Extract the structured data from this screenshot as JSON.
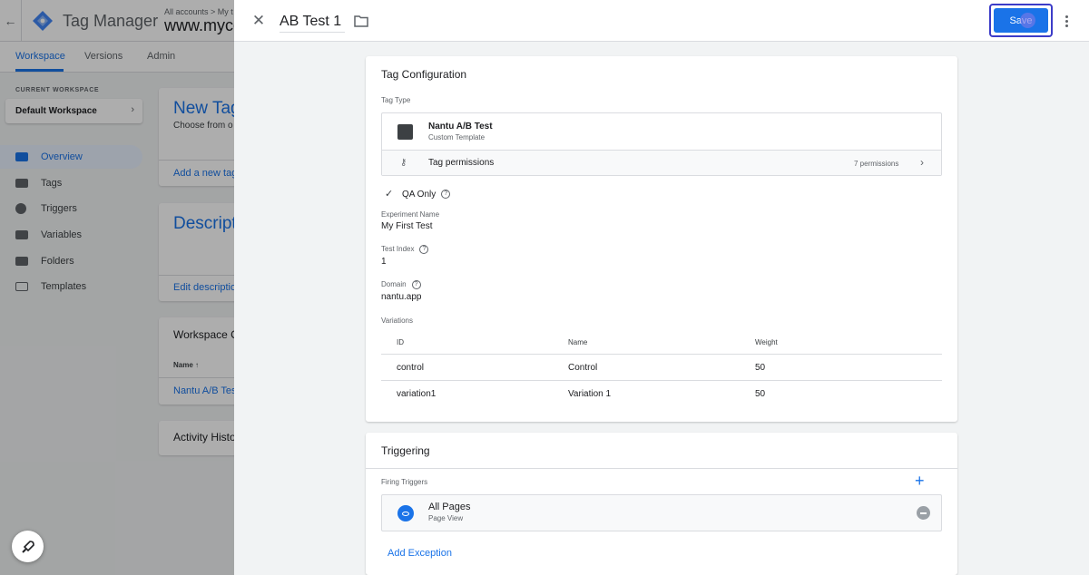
{
  "app": {
    "product_name": "Tag Manager",
    "account_crumb": "All accounts  >  My t",
    "container_name": "www.myco",
    "nav_tabs": [
      "Workspace",
      "Versions",
      "Admin"
    ],
    "current_workspace_label": "CURRENT WORKSPACE",
    "workspace_name": "Default Workspace",
    "sidebar": [
      {
        "label": "Overview",
        "icon": "overview-icon",
        "active": true
      },
      {
        "label": "Tags",
        "icon": "tag-icon"
      },
      {
        "label": "Triggers",
        "icon": "trigger-icon"
      },
      {
        "label": "Variables",
        "icon": "variables-icon"
      },
      {
        "label": "Folders",
        "icon": "folder-icon"
      },
      {
        "label": "Templates",
        "icon": "template-icon"
      }
    ],
    "cards": {
      "new_tag_title": "New Tag",
      "new_tag_sub": "Choose from o",
      "new_tag_link": "Add a new tag",
      "description_title": "Descript",
      "description_link": "Edit descriptio",
      "workspace_changes_title": "Workspace C",
      "name_col": "Name ↑",
      "row_name": "Nantu A/B Tes",
      "activity_title": "Activity Histo"
    }
  },
  "editor": {
    "tag_name": "AB Test 1",
    "save_label": "Save",
    "tag_configuration": {
      "title": "Tag Configuration",
      "tag_type_label": "Tag Type",
      "template_name": "Nantu A/B Test",
      "template_sub": "Custom Template",
      "permissions_label": "Tag permissions",
      "permissions_count": "7 permissions",
      "qa_only_label": "QA Only",
      "experiment_name_label": "Experiment Name",
      "experiment_name_value": "My First Test",
      "test_index_label": "Test Index",
      "test_index_value": "1",
      "domain_label": "Domain",
      "domain_value": "nantu.app",
      "variations_label": "Variations",
      "variations_headers": [
        "ID",
        "Name",
        "Weight"
      ],
      "variations_rows": [
        [
          "control",
          "Control",
          "50"
        ],
        [
          "variation1",
          "Variation 1",
          "50"
        ]
      ]
    },
    "triggering": {
      "title": "Triggering",
      "firing_label": "Firing Triggers",
      "trigger_name": "All Pages",
      "trigger_type": "Page View",
      "add_exception": "Add Exception"
    }
  },
  "colors": {
    "accent": "#1a73e8",
    "overlay": "rgba(0,0,0,0.32)",
    "focus_ring": "#3c3cc8"
  }
}
